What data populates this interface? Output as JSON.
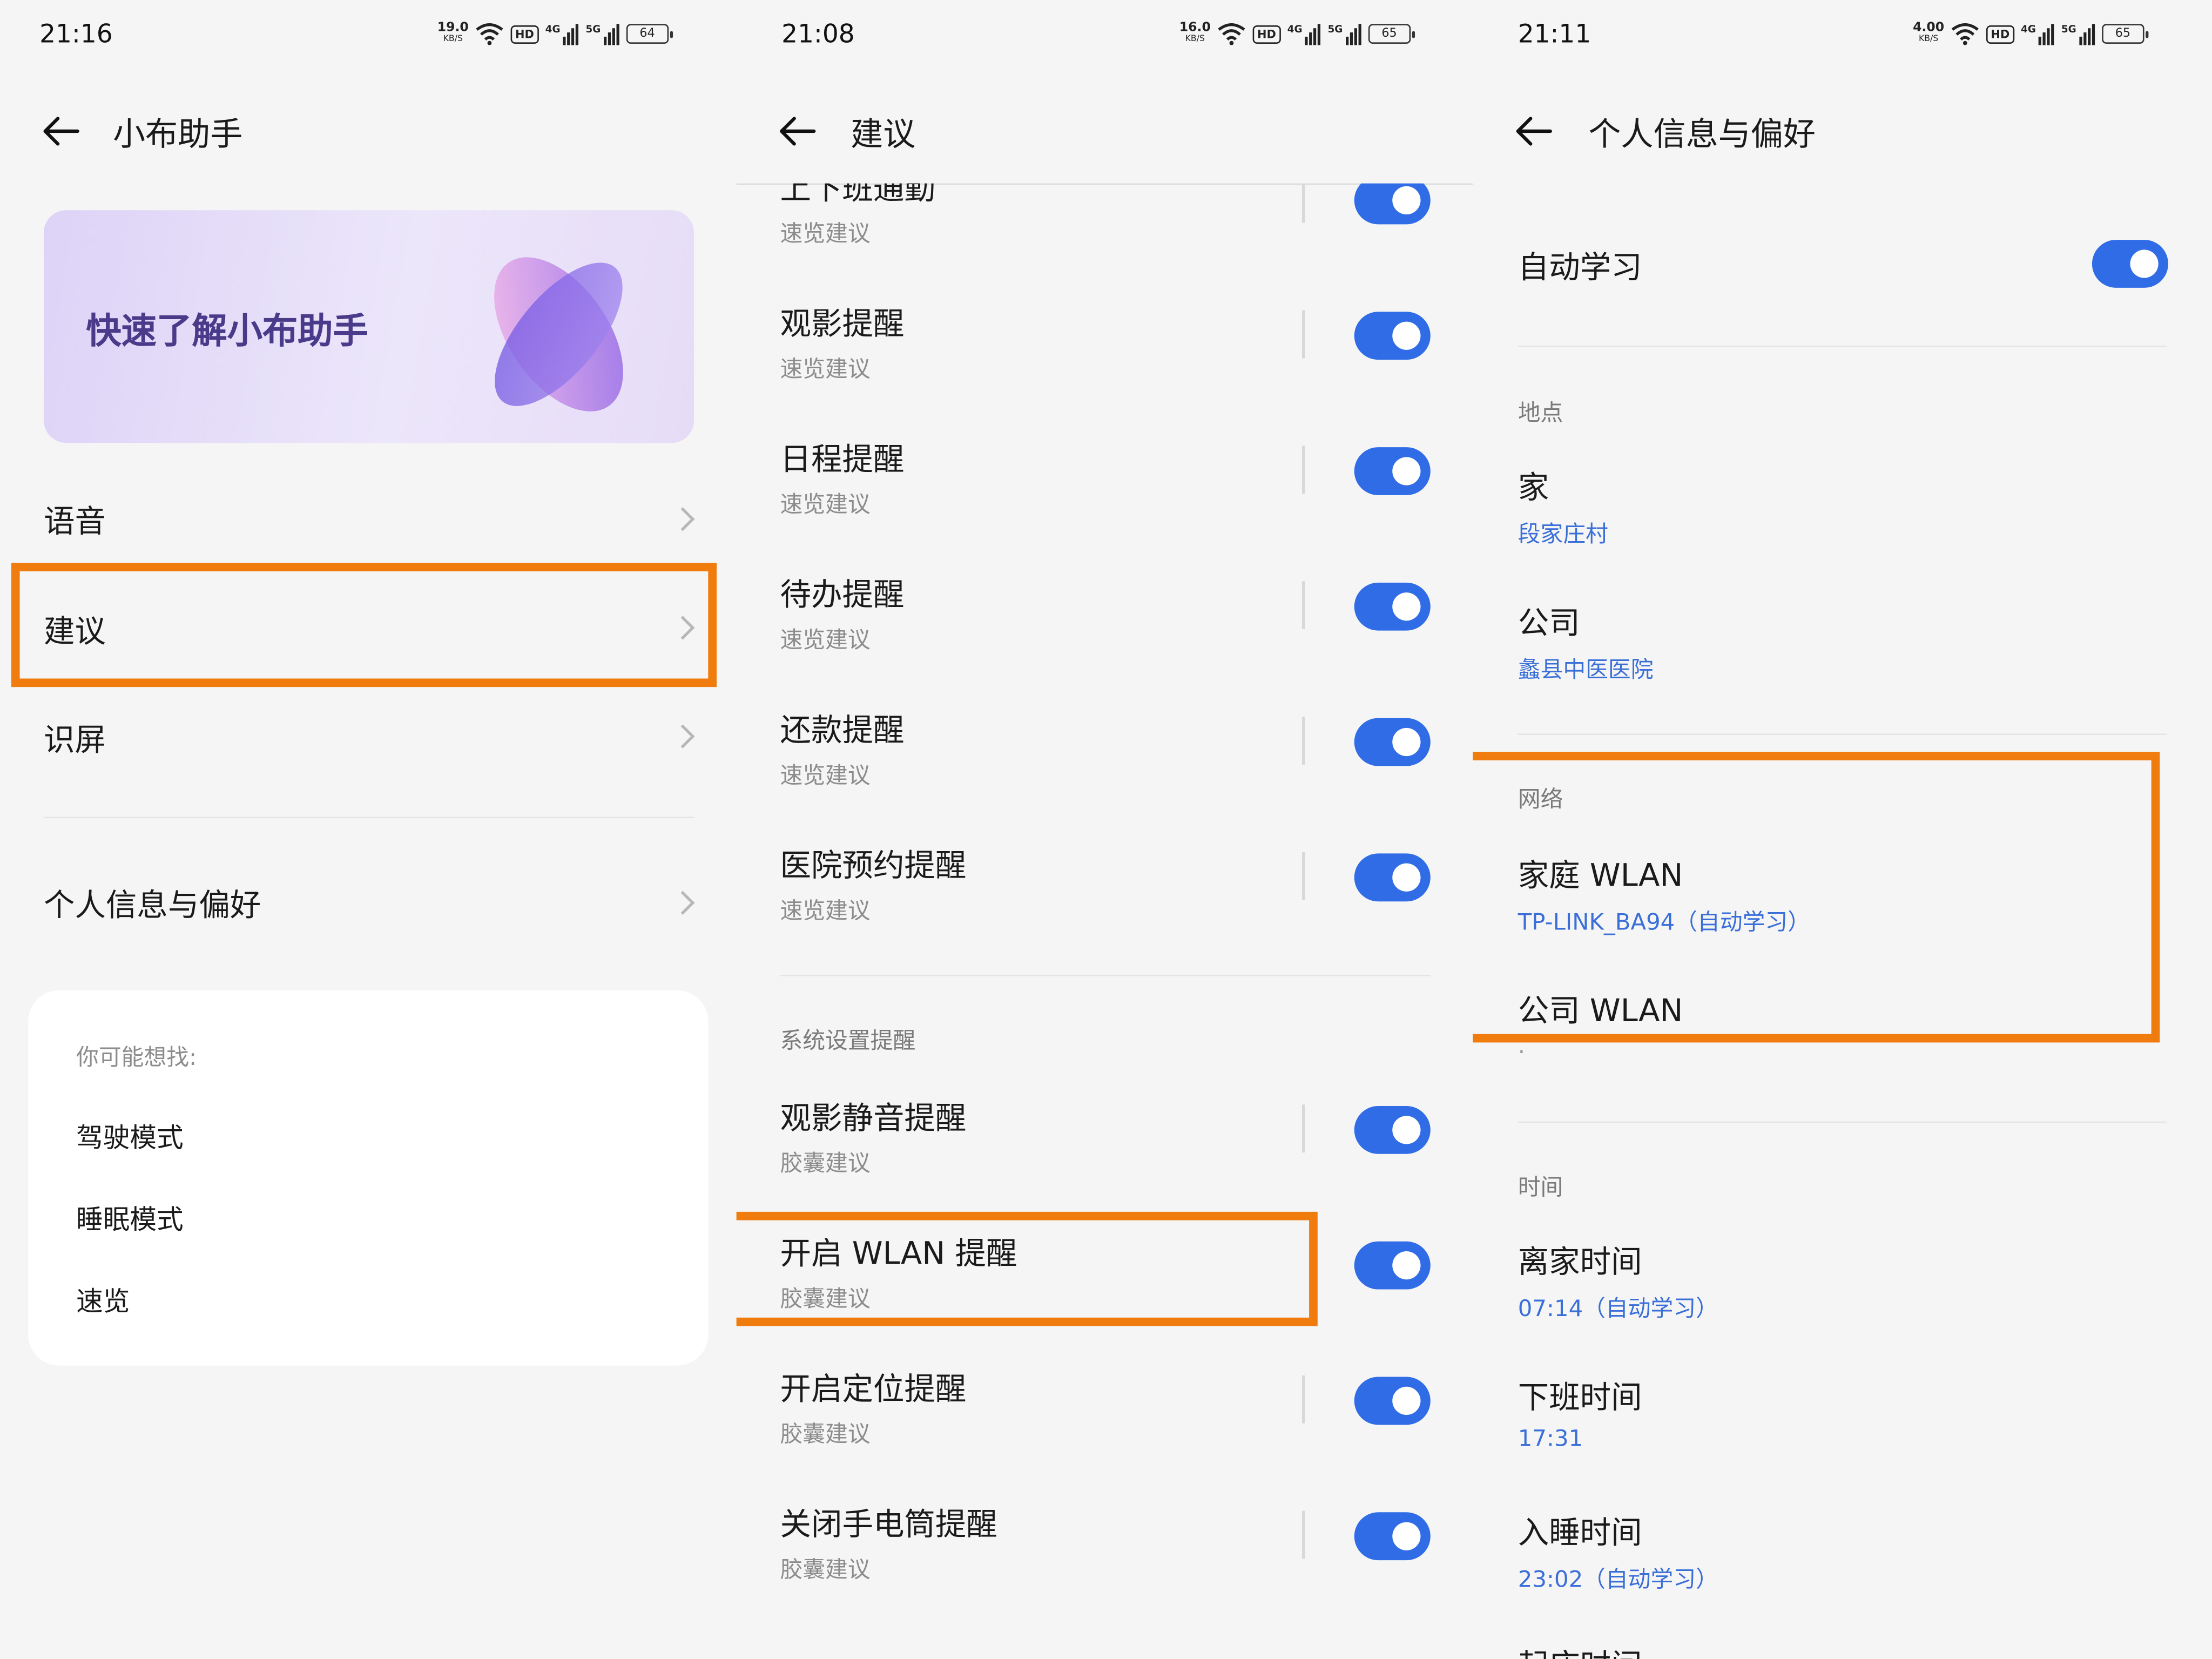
{
  "colors": {
    "accent": "#2f6ce6",
    "highlight": "#f07c0d",
    "link": "#3a6fd8",
    "background": "#f5f5f5"
  },
  "panel1": {
    "status": {
      "time": "21:16",
      "speed_value": "19.0",
      "speed_unit": "KB/S",
      "hd": "HD",
      "net1": "4G",
      "net2": "5G",
      "battery": "64"
    },
    "title": "小布助手",
    "banner": {
      "text": "快速了解小布助手"
    },
    "menu": [
      {
        "label": "语音"
      },
      {
        "label": "建议"
      },
      {
        "label": "识屏"
      }
    ],
    "personal": {
      "label": "个人信息与偏好"
    },
    "suggest_card": {
      "title": "你可能想找:",
      "items": [
        "驾驶模式",
        "睡眠模式",
        "速览"
      ]
    }
  },
  "panel2": {
    "status": {
      "time": "21:08",
      "speed_value": "16.0",
      "speed_unit": "KB/S",
      "hd": "HD",
      "net1": "4G",
      "net2": "5G",
      "battery": "65"
    },
    "title": "建议",
    "items": [
      {
        "title": "上下班通勤",
        "subtitle": "速览建议",
        "enabled": true
      },
      {
        "title": "观影提醒",
        "subtitle": "速览建议",
        "enabled": true
      },
      {
        "title": "日程提醒",
        "subtitle": "速览建议",
        "enabled": true
      },
      {
        "title": "待办提醒",
        "subtitle": "速览建议",
        "enabled": true
      },
      {
        "title": "还款提醒",
        "subtitle": "速览建议",
        "enabled": true
      },
      {
        "title": "医院预约提醒",
        "subtitle": "速览建议",
        "enabled": true
      }
    ],
    "section_title": "系统设置提醒",
    "system_items": [
      {
        "title": "观影静音提醒",
        "subtitle": "胶囊建议",
        "enabled": true
      },
      {
        "title": "开启 WLAN 提醒",
        "subtitle": "胶囊建议",
        "enabled": true
      },
      {
        "title": "开启定位提醒",
        "subtitle": "胶囊建议",
        "enabled": true
      },
      {
        "title": "关闭手电筒提醒",
        "subtitle": "胶囊建议",
        "enabled": true
      }
    ]
  },
  "panel3": {
    "status": {
      "time": "21:11",
      "speed_value": "4.00",
      "speed_unit": "KB/S",
      "hd": "HD",
      "net1": "4G",
      "net2": "5G",
      "battery": "65"
    },
    "title": "个人信息与偏好",
    "auto_learn": {
      "label": "自动学习",
      "enabled": true
    },
    "location": {
      "section": "地点",
      "home_label": "家",
      "home_value": "段家庄村",
      "work_label": "公司",
      "work_value": "蠡县中医医院"
    },
    "network": {
      "section": "网络",
      "home_wlan_label": "家庭 WLAN",
      "home_wlan_value": "TP-LINK_BA94（自动学习）",
      "work_wlan_label": "公司 WLAN",
      "work_wlan_value": "·"
    },
    "time": {
      "section": "时间",
      "leave_label": "离家时间",
      "leave_value": "07:14（自动学习）",
      "offwork_label": "下班时间",
      "offwork_value": "17:31",
      "sleep_label": "入睡时间",
      "sleep_value": "23:02（自动学习）",
      "wake_label": "起床时间"
    }
  }
}
